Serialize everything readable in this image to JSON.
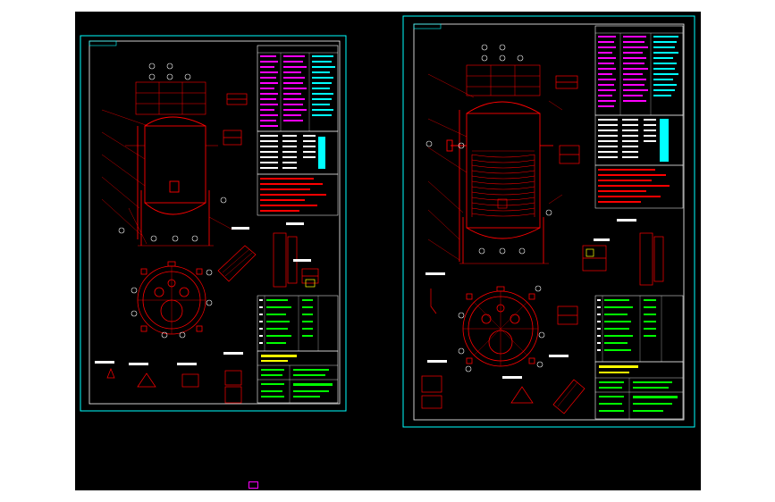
{
  "viewport": {
    "background": "#000000",
    "page_background": "#ffffff"
  },
  "colors": {
    "sheet_border": "#00ffff",
    "inner_border": "#ffffff",
    "geometry": "#ff0000",
    "magenta_text": "#ff00ff",
    "cyan_text": "#00ffff",
    "green_text": "#00ff00",
    "yellow_text": "#ffff00",
    "white_text": "#ffffff"
  },
  "sheets": [
    {
      "name": "drawing-sheet-left",
      "views": [
        "vessel-elevation",
        "top-view",
        "details",
        "technical-table",
        "nozzle-table",
        "title-block"
      ]
    },
    {
      "name": "drawing-sheet-right",
      "views": [
        "vessel-elevation-with-coil",
        "top-view",
        "details",
        "technical-table",
        "nozzle-table",
        "title-block"
      ]
    }
  ],
  "icons": {
    "layout_tab": "layout-tab-icon"
  }
}
